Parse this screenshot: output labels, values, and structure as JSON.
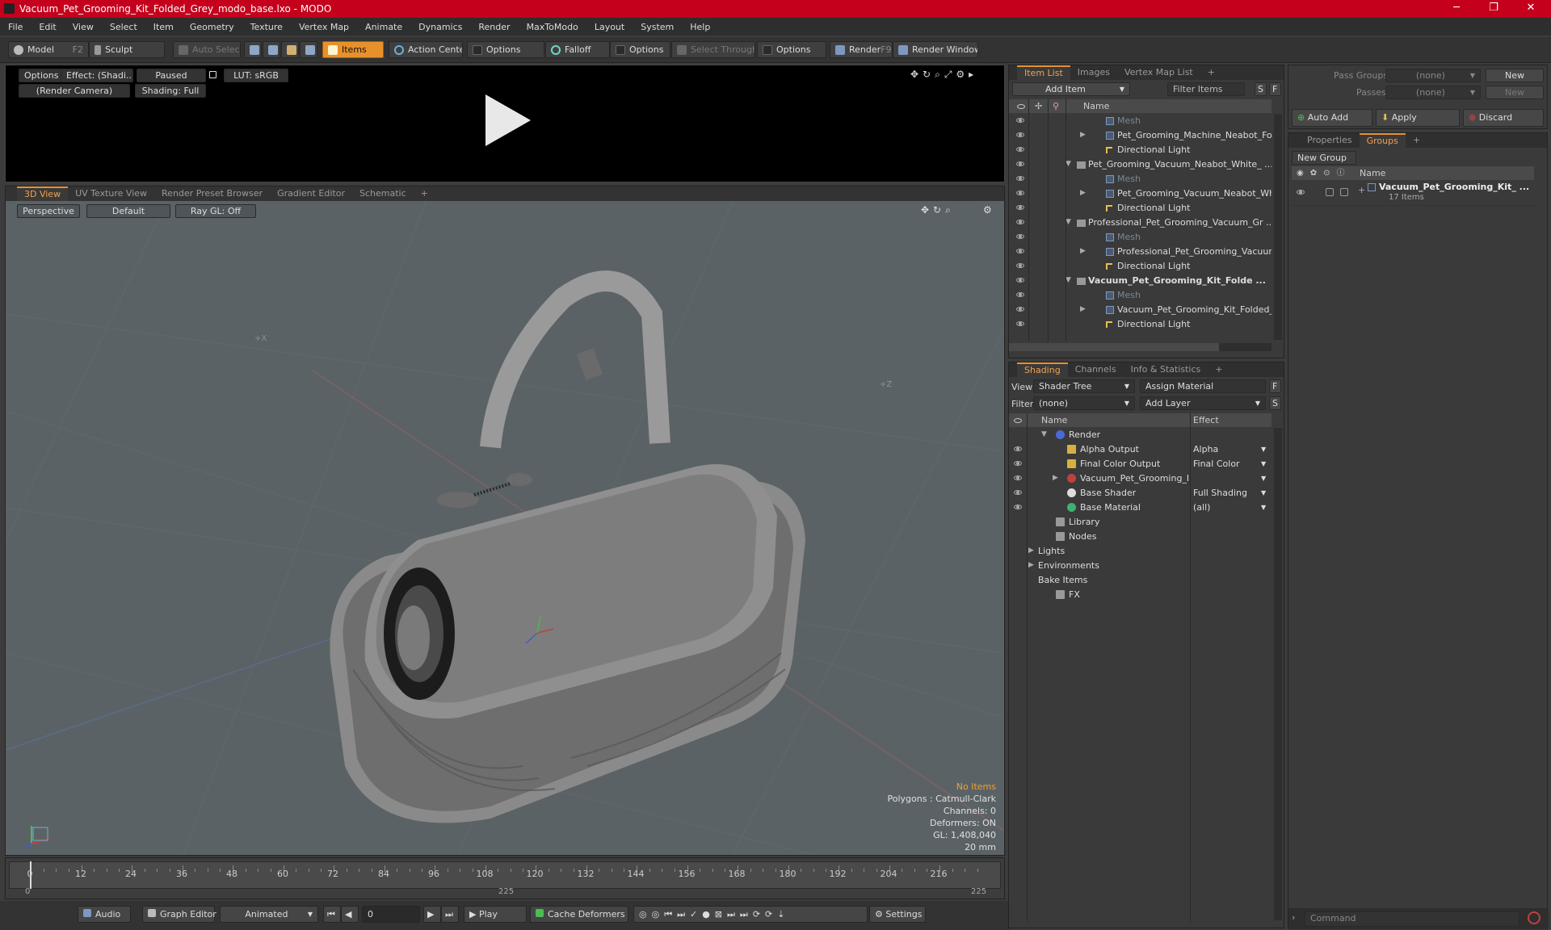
{
  "window": {
    "title": "Vacuum_Pet_Grooming_Kit_Folded_Grey_modo_base.lxo - MODO",
    "minimize": "─",
    "maximize": "❐",
    "close": "✕"
  },
  "menu": [
    "File",
    "Edit",
    "View",
    "Select",
    "Item",
    "Geometry",
    "Texture",
    "Vertex Map",
    "Animate",
    "Dynamics",
    "Render",
    "MaxToModo",
    "Layout",
    "System",
    "Help"
  ],
  "toolbar": {
    "model": "Model",
    "model_key": "F2",
    "sculpt": "Sculpt",
    "auto_select": "Auto Select",
    "items": "Items",
    "action_center": "Action Center",
    "options1": "Options",
    "falloff": "Falloff",
    "options2": "Options",
    "select_through": "Select Through",
    "options3": "Options",
    "render": "Render",
    "render_key": "F9",
    "render_window": "Render Window"
  },
  "preview": {
    "options": "Options",
    "effect": "Effect: (Shadi...",
    "paused": "Paused",
    "lut": "LUT: sRGB",
    "camera": "(Render Camera)",
    "shading": "Shading: Full"
  },
  "viewport": {
    "tabs": [
      "3D View",
      "UV Texture View",
      "Render Preset Browser",
      "Gradient Editor",
      "Schematic"
    ],
    "add_tab": "+",
    "perspective": "Perspective",
    "default": "Default",
    "raygl": "Ray GL: Off",
    "axis_x": "+X",
    "axis_z": "+Z",
    "stats": {
      "no_items": "No Items",
      "polygons": "Polygons : Catmull-Clark",
      "channels": "Channels: 0",
      "deformers": "Deformers: ON",
      "gl": "GL: 1,408,040",
      "unit": "20 mm"
    }
  },
  "item_list": {
    "tabs": [
      "Item List",
      "Images",
      "Vertex Map List"
    ],
    "add_tab": "+",
    "add_item": "Add Item",
    "filter": "Filter Items",
    "s": "S",
    "f": "F",
    "col_name": "Name",
    "rows": [
      {
        "label": "Mesh",
        "indent": 2,
        "kind": "mesh",
        "dim": true,
        "bold": false,
        "exp": ""
      },
      {
        "label": "Pet_Grooming_Machine_Neabot_Fold ...",
        "indent": 2,
        "kind": "mesh",
        "dim": false,
        "bold": false,
        "exp": "▶"
      },
      {
        "label": "Directional Light",
        "indent": 2,
        "kind": "light",
        "dim": false,
        "bold": false,
        "exp": ""
      },
      {
        "label": "Pet_Grooming_Vacuum_Neabot_White_ ...",
        "indent": 1,
        "kind": "scene",
        "dim": false,
        "bold": false,
        "exp": "▼"
      },
      {
        "label": "Mesh",
        "indent": 2,
        "kind": "mesh",
        "dim": true,
        "bold": false,
        "exp": ""
      },
      {
        "label": "Pet_Grooming_Vacuum_Neabot_Whit ...",
        "indent": 2,
        "kind": "mesh",
        "dim": false,
        "bold": false,
        "exp": "▶"
      },
      {
        "label": "Directional Light",
        "indent": 2,
        "kind": "light",
        "dim": false,
        "bold": false,
        "exp": ""
      },
      {
        "label": "Professional_Pet_Grooming_Vacuum_Gr ...",
        "indent": 1,
        "kind": "scene",
        "dim": false,
        "bold": false,
        "exp": "▼"
      },
      {
        "label": "Mesh",
        "indent": 2,
        "kind": "mesh",
        "dim": true,
        "bold": false,
        "exp": ""
      },
      {
        "label": "Professional_Pet_Grooming_Vacuum_ ...",
        "indent": 2,
        "kind": "mesh",
        "dim": false,
        "bold": false,
        "exp": "▶"
      },
      {
        "label": "Directional Light",
        "indent": 2,
        "kind": "light",
        "dim": false,
        "bold": false,
        "exp": ""
      },
      {
        "label": "Vacuum_Pet_Grooming_Kit_Folde ...",
        "indent": 1,
        "kind": "scene",
        "dim": false,
        "bold": true,
        "exp": "▼"
      },
      {
        "label": "Mesh",
        "indent": 2,
        "kind": "mesh",
        "dim": true,
        "bold": false,
        "exp": ""
      },
      {
        "label": "Vacuum_Pet_Grooming_Kit_Folded_Gr ...",
        "indent": 2,
        "kind": "mesh",
        "dim": false,
        "bold": false,
        "exp": "▶"
      },
      {
        "label": "Directional Light",
        "indent": 2,
        "kind": "light",
        "dim": false,
        "bold": false,
        "exp": ""
      }
    ]
  },
  "shading": {
    "tabs": [
      "Shading",
      "Channels",
      "Info & Statistics"
    ],
    "add_tab": "+",
    "view_label": "View",
    "view": "Shader Tree",
    "assign": "Assign Material",
    "filter_label": "Filter",
    "filter": "(none)",
    "add_layer": "Add Layer",
    "f": "F",
    "s": "S",
    "col_name": "Name",
    "col_effect": "Effect",
    "rows": [
      {
        "label": "Render",
        "effect": "",
        "indent": 1,
        "kind": "render",
        "exp": "▼",
        "eye": false
      },
      {
        "label": "Alpha Output",
        "effect": "Alpha",
        "indent": 2,
        "kind": "output",
        "exp": "",
        "eye": true
      },
      {
        "label": "Final Color Output",
        "effect": "Final Color",
        "indent": 2,
        "kind": "output",
        "exp": "",
        "eye": true
      },
      {
        "label": "Vacuum_Pet_Grooming_Kit ...",
        "effect": "",
        "indent": 2,
        "kind": "mat",
        "exp": "▶",
        "eye": true
      },
      {
        "label": "Base Shader",
        "effect": "Full Shading",
        "indent": 2,
        "kind": "shader",
        "exp": "",
        "eye": true
      },
      {
        "label": "Base Material",
        "effect": "(all)",
        "indent": 2,
        "kind": "basemat",
        "exp": "",
        "eye": true
      },
      {
        "label": "Library",
        "effect": "",
        "indent": 1,
        "kind": "folder",
        "exp": "",
        "eye": false
      },
      {
        "label": "Nodes",
        "effect": "",
        "indent": 1,
        "kind": "folder",
        "exp": "",
        "eye": false
      },
      {
        "label": "Lights",
        "effect": "",
        "indent": 0,
        "kind": "none",
        "exp": "▶",
        "eye": false
      },
      {
        "label": "Environments",
        "effect": "",
        "indent": 0,
        "kind": "none",
        "exp": "▶",
        "eye": false
      },
      {
        "label": "Bake Items",
        "effect": "",
        "indent": 0,
        "kind": "none",
        "exp": "",
        "eye": false
      },
      {
        "label": "FX",
        "effect": "",
        "indent": 1,
        "kind": "fx",
        "exp": "",
        "eye": false
      }
    ]
  },
  "groups": {
    "pass_groups": "Pass Groups",
    "passes": "Passes",
    "none": "(none)",
    "new": "New",
    "auto_add": "Auto Add",
    "apply": "Apply",
    "discard": "Discard",
    "tabs": [
      "Properties",
      "Groups"
    ],
    "add_tab": "+",
    "new_group": "New Group",
    "col_name": "Name",
    "group_name": "Vacuum_Pet_Grooming_Kit_ ...",
    "group_count": "17 Items"
  },
  "timeline": {
    "ticks": [
      "0",
      "12",
      "24",
      "36",
      "48",
      "60",
      "72",
      "84",
      "96",
      "108",
      "120",
      "132",
      "144",
      "156",
      "168",
      "180",
      "192",
      "204",
      "216"
    ],
    "start": "0",
    "mid": "225",
    "end": "225"
  },
  "transport": {
    "audio": "Audio",
    "graph_editor": "Graph Editor",
    "animated": "Animated",
    "frame": "0",
    "play": "Play",
    "cache": "Cache Deformers",
    "settings": "Settings"
  },
  "command": {
    "placeholder": "Command"
  },
  "colors": {
    "accent": "#e89030",
    "titlebar": "#c4001c",
    "viewport": "#5b6266"
  }
}
